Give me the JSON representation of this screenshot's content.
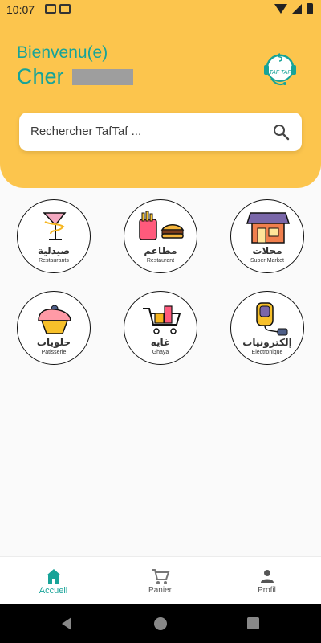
{
  "status": {
    "time": "10:07"
  },
  "header": {
    "welcome": "Bienvenu(e)",
    "greeting_prefix": "Cher",
    "logo_text": "TAF TAF"
  },
  "search": {
    "placeholder": "Rechercher TafTaf ..."
  },
  "categories": [
    {
      "primary": "صيدلية",
      "secondary": "Restaurants"
    },
    {
      "primary": "مطاعم",
      "secondary": "Restaurant"
    },
    {
      "primary": "محلات",
      "secondary": "Super Market"
    },
    {
      "primary": "حلويات",
      "secondary": "Patisserie"
    },
    {
      "primary": "غايه",
      "secondary": "Ghaya"
    },
    {
      "primary": "إلكترونيات",
      "secondary": "Electronique"
    }
  ],
  "bottom_nav": {
    "items": [
      {
        "label": "Accueil",
        "icon": "home-icon",
        "active": true
      },
      {
        "label": "Panier",
        "icon": "cart-icon",
        "active": false
      },
      {
        "label": "Profil",
        "icon": "profile-icon",
        "active": false
      }
    ]
  },
  "colors": {
    "header_bg": "#fcc54d",
    "accent": "#17a398",
    "username_redaction": "#9e9e9e"
  }
}
